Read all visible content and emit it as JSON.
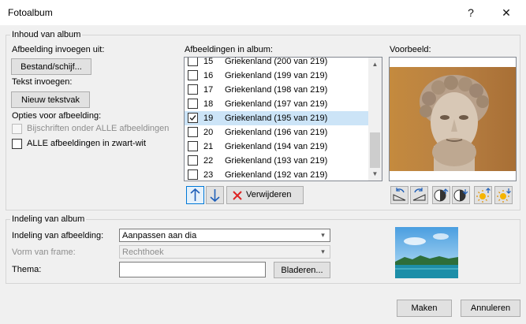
{
  "window": {
    "title": "Fotoalbum",
    "help_label": "?",
    "close_label": "✕"
  },
  "album_content": {
    "legend": "Inhoud van album",
    "insert_picture_label": "Afbeelding invoegen uit:",
    "file_disk_button": "Bestand/schijf...",
    "insert_text_label": "Tekst invoegen:",
    "new_textbox_button": "Nieuw tekstvak",
    "picture_options_label": "Opties voor afbeelding:",
    "captions_below_label": "Bijschriften onder ALLE afbeeldingen",
    "captions_below_checked": false,
    "captions_below_disabled": true,
    "black_white_label": "ALLE afbeeldingen in zwart-wit",
    "black_white_checked": false
  },
  "picture_list": {
    "label": "Afbeeldingen in album:",
    "items": [
      {
        "num": "15",
        "name": "Griekenland (200 van 219)",
        "checked": false,
        "selected": false
      },
      {
        "num": "16",
        "name": "Griekenland (199 van 219)",
        "checked": false,
        "selected": false
      },
      {
        "num": "17",
        "name": "Griekenland (198 van 219)",
        "checked": false,
        "selected": false
      },
      {
        "num": "18",
        "name": "Griekenland (197 van 219)",
        "checked": false,
        "selected": false
      },
      {
        "num": "19",
        "name": "Griekenland (195 van 219)",
        "checked": true,
        "selected": true
      },
      {
        "num": "20",
        "name": "Griekenland (196 van 219)",
        "checked": false,
        "selected": false
      },
      {
        "num": "21",
        "name": "Griekenland (194 van 219)",
        "checked": false,
        "selected": false
      },
      {
        "num": "22",
        "name": "Griekenland (193 van 219)",
        "checked": false,
        "selected": false
      },
      {
        "num": "23",
        "name": "Griekenland (192 van 219)",
        "checked": false,
        "selected": false
      }
    ],
    "move_up_icon": "arrow-up-icon",
    "move_down_icon": "arrow-down-icon",
    "remove_button": "Verwijderen",
    "remove_icon": "red-x-icon"
  },
  "preview": {
    "label": "Voorbeeld:",
    "tool_icons": [
      "rotate-left-icon",
      "rotate-right-icon",
      "contrast-up-icon",
      "contrast-down-icon",
      "brightness-up-icon",
      "brightness-down-icon"
    ]
  },
  "album_layout": {
    "legend": "Indeling van album",
    "picture_layout_label": "Indeling van afbeelding:",
    "picture_layout_value": "Aanpassen aan dia",
    "frame_shape_label": "Vorm van frame:",
    "frame_shape_value": "Rechthoek",
    "frame_shape_disabled": true,
    "theme_label": "Thema:",
    "theme_value": "",
    "browse_button": "Bladeren..."
  },
  "footer": {
    "create_button": "Maken",
    "cancel_button": "Annuleren"
  }
}
